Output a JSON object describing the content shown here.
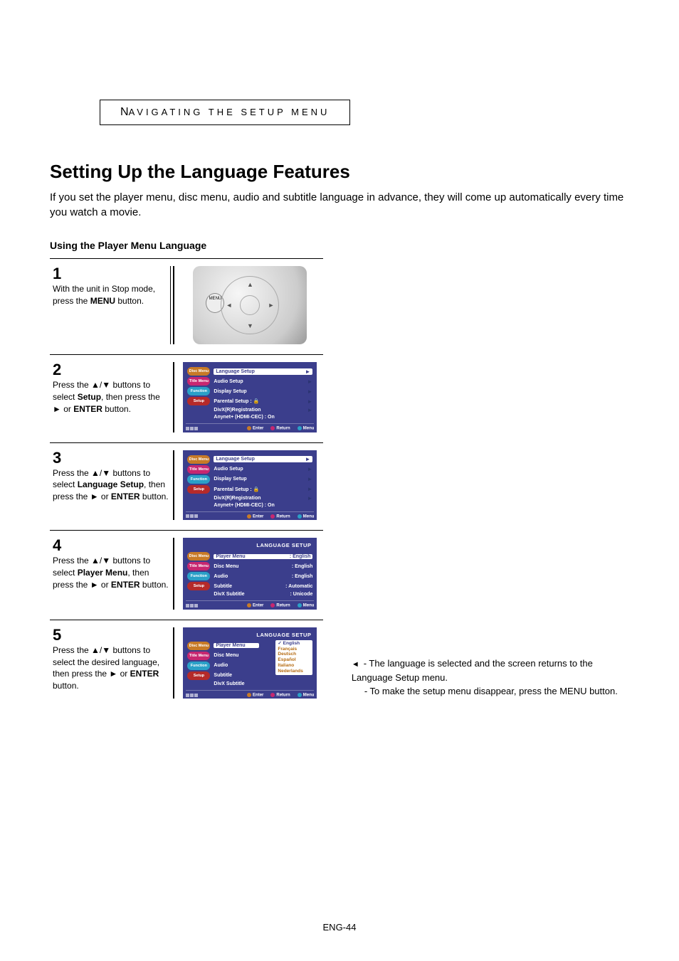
{
  "section_label": {
    "first": "N",
    "rest": "AVIGATING THE SETUP MENU"
  },
  "heading": "Setting Up the Language Features",
  "intro": "If you set the player menu, disc menu, audio and subtitle language in advance, they will come up automatically every time you watch a movie.",
  "subhead": "Using the Player Menu Language",
  "steps": {
    "s1": {
      "num": "1",
      "t_a": "With the unit in Stop mode, press the ",
      "t_b": "MENU",
      "t_c": " button."
    },
    "s2": {
      "num": "2",
      "t_a": "Press the ▲/▼ buttons to select ",
      "t_b": "Setup",
      "t_c": ", then press the ► or ",
      "t_d": "ENTER",
      "t_e": " button."
    },
    "s3": {
      "num": "3",
      "t_a": "Press the ▲/▼ buttons to select ",
      "t_b": "Language Setup",
      "t_c": ", then press the ► or ",
      "t_d": "ENTER",
      "t_e": " button."
    },
    "s4": {
      "num": "4",
      "t_a": "Press the ▲/▼ buttons to select ",
      "t_b": "Player Menu",
      "t_c": ", then press the ► or ",
      "t_d": "ENTER",
      "t_e": " button."
    },
    "s5": {
      "num": "5",
      "t_a": "Press the ▲/▼ buttons to select the desired language, then press the ► or ",
      "t_b": "ENTER",
      "t_c": " button."
    }
  },
  "remote": {
    "menu": "MENU"
  },
  "osd_common": {
    "side": {
      "disc": "Disc Menu",
      "title": "Title Menu",
      "func": "Function",
      "setup": "Setup"
    },
    "footer": {
      "enter": "Enter",
      "return": "Return",
      "menu": "Menu"
    }
  },
  "osd2": {
    "items": [
      {
        "label": "Language Setup",
        "sel": true
      },
      {
        "label": "Audio Setup"
      },
      {
        "label": "Display Setup"
      },
      {
        "label": "Parental Setup :",
        "lock": true
      },
      {
        "label": "DivX(R)Registration"
      },
      {
        "label": "Anynet+ (HDMI-CEC) : On",
        "nochev": true
      }
    ]
  },
  "osd3": {
    "items": [
      {
        "label": "Language Setup",
        "sel": true
      },
      {
        "label": "Audio Setup"
      },
      {
        "label": "Display Setup"
      },
      {
        "label": "Parental Setup :",
        "lock": true
      },
      {
        "label": "DivX(R)Registration"
      },
      {
        "label": "Anynet+ (HDMI-CEC) : On",
        "nochev": true
      }
    ]
  },
  "osd4": {
    "title": "LANGUAGE SETUP",
    "items": [
      {
        "label": "Player Menu",
        "val": "English",
        "sel": true
      },
      {
        "label": "Disc Menu",
        "val": "English"
      },
      {
        "label": "Audio",
        "val": "English"
      },
      {
        "label": "Subtitle",
        "val": "Automatic"
      },
      {
        "label": "DivX Subtitle",
        "val": "Unicode"
      }
    ]
  },
  "osd5": {
    "title": "LANGUAGE SETUP",
    "left": [
      {
        "label": "Player Menu",
        "sel": true
      },
      {
        "label": "Disc Menu"
      },
      {
        "label": "Audio"
      },
      {
        "label": "Subtitle"
      },
      {
        "label": "DivX Subtitle"
      }
    ],
    "opts": [
      "English",
      "Français",
      "Deutsch",
      "Español",
      "Italiano",
      "Nederlands"
    ],
    "sel_opt": "English"
  },
  "notes": {
    "n1": "- The language is selected and the screen returns to the Language Setup menu.",
    "n2": "- To make the setup menu disappear, press the MENU button."
  },
  "pagenum": "ENG-44"
}
